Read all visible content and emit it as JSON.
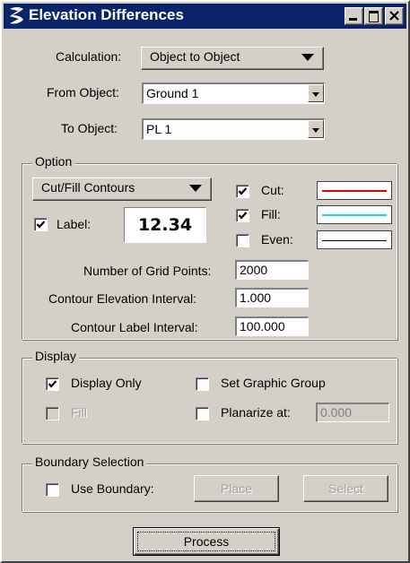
{
  "window": {
    "title": "Elevation Differences",
    "controls": {
      "minimize": "minimize-icon",
      "maximize": "maximize-icon",
      "close": "close-icon"
    }
  },
  "calculation": {
    "label": "Calculation:",
    "value": "Object to Object"
  },
  "from_object": {
    "label": "From Object:",
    "value": "Ground 1"
  },
  "to_object": {
    "label": "To Object:",
    "value": "PL 1"
  },
  "option": {
    "title": "Option",
    "mode": "Cut/Fill Contours",
    "label_check": {
      "label": "Label:",
      "checked": true
    },
    "label_preview": "12.34",
    "cut": {
      "label": "Cut:",
      "checked": true,
      "color": "#e00000"
    },
    "fill": {
      "label": "Fill:",
      "checked": true,
      "color": "#00e0e8"
    },
    "even": {
      "label": "Even:",
      "checked": false,
      "color": "#000000"
    },
    "grid_points": {
      "label": "Number of Grid Points:",
      "value": "2000"
    },
    "elev_interval": {
      "label": "Contour Elevation Interval:",
      "value": "1.000"
    },
    "label_interval": {
      "label": "Contour Label Interval:",
      "value": "100.000"
    }
  },
  "display": {
    "title": "Display",
    "display_only": {
      "label": "Display Only",
      "checked": true
    },
    "fill": {
      "label": "Fill",
      "checked": false,
      "disabled": true
    },
    "set_graphic_group": {
      "label": "Set Graphic Group",
      "checked": false
    },
    "planarize": {
      "label": "Planarize at:",
      "checked": false,
      "value": "0.000"
    }
  },
  "boundary": {
    "title": "Boundary Selection",
    "use_boundary": {
      "label": "Use Boundary:",
      "checked": false
    },
    "place_label": "Place",
    "select_label": "Select"
  },
  "process_label": "Process"
}
